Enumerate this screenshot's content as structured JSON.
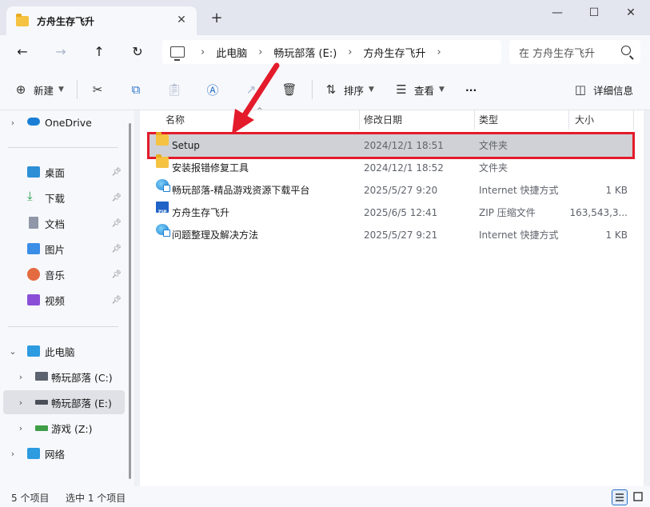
{
  "titlebar": {
    "tab_title": "方舟生存飞升",
    "close_glyph": "✕",
    "add_glyph": "+",
    "minimize_glyph": "—",
    "maximize_glyph": "☐",
    "window_close_glyph": "✕"
  },
  "nav": {
    "back_glyph": "←",
    "forward_glyph": "→",
    "up_glyph": "↑",
    "refresh_glyph": "↻",
    "breadcrumbs": [
      "此电脑",
      "畅玩部落 (E:)",
      "方舟生存飞升"
    ],
    "separator": "›",
    "search_placeholder": "在 方舟生存飞升"
  },
  "toolbar": {
    "new_label": "新建",
    "sort_label": "排序",
    "view_label": "查看",
    "more_label": "···",
    "details_label": "详细信息"
  },
  "sidebar": {
    "onedrive": "OneDrive",
    "quick": [
      "桌面",
      "下载",
      "文档",
      "图片",
      "音乐",
      "视频"
    ],
    "this_pc": "此电脑",
    "drives": [
      "畅玩部落 (C:)",
      "畅玩部落 (E:)",
      "游戏 (Z:)"
    ],
    "network": "网络"
  },
  "columns": {
    "name": "名称",
    "date": "修改日期",
    "type": "类型",
    "size": "大小"
  },
  "files": [
    {
      "name": "Setup",
      "date": "2024/12/1 18:51",
      "type": "文件夹",
      "size": "",
      "icon": "folder-icon"
    },
    {
      "name": "安装报错修复工具",
      "date": "2024/12/1 18:52",
      "type": "文件夹",
      "size": "",
      "icon": "folder-icon"
    },
    {
      "name": "畅玩部落-精品游戏资源下载平台",
      "date": "2025/5/27 9:20",
      "type": "Internet 快捷方式",
      "size": "1 KB",
      "icon": "internet-shortcut-icon"
    },
    {
      "name": "方舟生存飞升",
      "date": "2025/6/5 12:41",
      "type": "ZIP 压缩文件",
      "size": "163,543,3...",
      "icon": "zip-file-icon"
    },
    {
      "name": "问题整理及解决方法",
      "date": "2025/5/27 9:21",
      "type": "Internet 快捷方式",
      "size": "1 KB",
      "icon": "internet-shortcut-icon"
    }
  ],
  "status": {
    "count": "5 个项目",
    "selected": "选中 1 个项目"
  },
  "colors": {
    "highlight_border": "#e31b2b",
    "folder": "#f5c242",
    "accent": "#1a7fd4"
  }
}
